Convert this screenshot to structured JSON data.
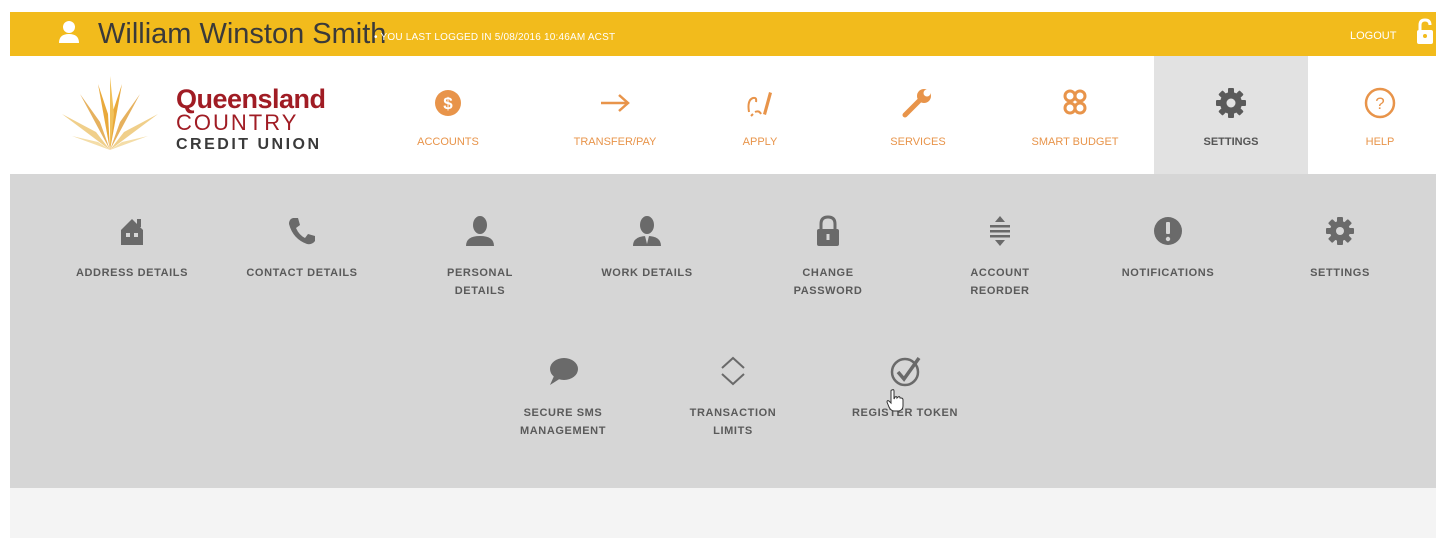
{
  "header": {
    "user_name": "William Winston Smith",
    "last_login": "• YOU LAST LOGGED IN 5/08/2016 10:46AM ACST",
    "logout_label": "LOGOUT",
    "user_icon": "user-icon",
    "lock_icon": "unlock-icon",
    "bar_color": "#f2bb1c"
  },
  "logo": {
    "line1": "Queensland",
    "line2": "COUNTRY",
    "line3": "CREDIT UNION",
    "brand_color": "#a01c24"
  },
  "nav": {
    "accent_color": "#e8944a",
    "items": [
      {
        "label": "ACCOUNTS",
        "icon": "dollar-coin-icon"
      },
      {
        "label": "TRANSFER/PAY",
        "icon": "arrow-right-icon"
      },
      {
        "label": "APPLY",
        "icon": "pen-icon"
      },
      {
        "label": "SERVICES",
        "icon": "wrench-icon"
      },
      {
        "label": "SMART BUDGET",
        "icon": "knot-icon"
      },
      {
        "label": "SETTINGS",
        "icon": "gear-icon",
        "active": true
      },
      {
        "label": "HELP",
        "icon": "help-circle-icon"
      }
    ]
  },
  "settings_menu": {
    "row1": [
      {
        "label": "ADDRESS DETAILS",
        "icon": "house-icon"
      },
      {
        "label": "CONTACT DETAILS",
        "icon": "phone-icon"
      },
      {
        "label": "PERSONAL\nDETAILS",
        "icon": "person-icon"
      },
      {
        "label": "WORK DETAILS",
        "icon": "business-person-icon"
      },
      {
        "label": "CHANGE\nPASSWORD",
        "icon": "padlock-icon"
      },
      {
        "label": "ACCOUNT\nREORDER",
        "icon": "reorder-icon"
      },
      {
        "label": "NOTIFICATIONS",
        "icon": "exclamation-icon"
      },
      {
        "label": "SETTINGS",
        "icon": "gear-icon"
      }
    ],
    "row2": [
      {
        "label": "SECURE SMS\nMANAGEMENT",
        "icon": "speech-bubble-icon"
      },
      {
        "label": "TRANSACTION\nLIMITS",
        "icon": "up-down-chevron-icon"
      },
      {
        "label": "REGISTER TOKEN",
        "icon": "check-circle-icon"
      }
    ]
  }
}
